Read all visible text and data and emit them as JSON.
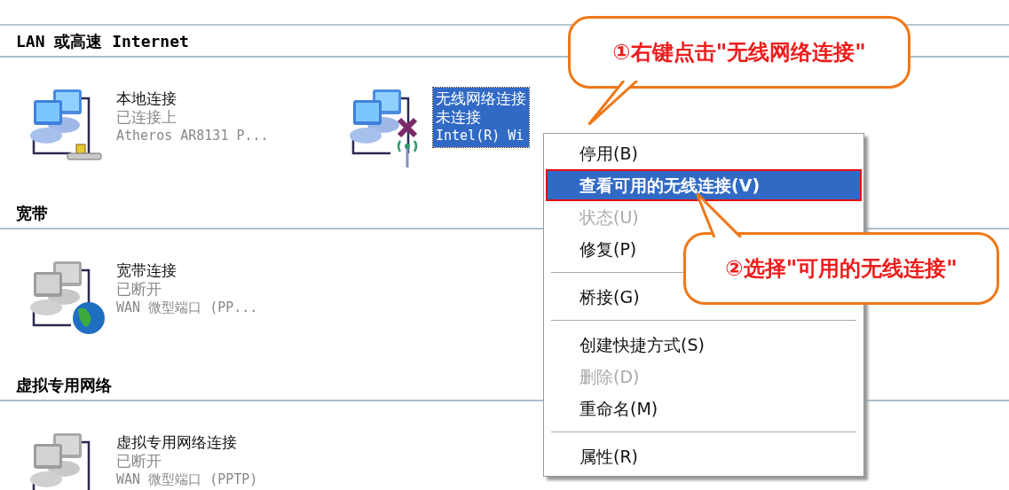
{
  "sections": [
    {
      "title": "LAN 或高速 Internet",
      "items": [
        {
          "kind": "lan",
          "name": "本地连接",
          "status": "已连接上",
          "device": "Atheros AR8131 P...",
          "selected": false
        },
        {
          "kind": "wireless",
          "name": "无线网络连接",
          "status": "未连接",
          "device": "Intel(R) Wi",
          "selected": true
        }
      ]
    },
    {
      "title": "宽带",
      "items": [
        {
          "kind": "broadband",
          "name": "宽带连接",
          "status": "已断开",
          "device": "WAN 微型端口 (PP...",
          "selected": false
        }
      ]
    },
    {
      "title": "虚拟专用网络",
      "items": [
        {
          "kind": "vpn",
          "name": "虚拟专用网络连接",
          "status": "已断开",
          "device": "WAN 微型端口 (PPTP)",
          "selected": false
        }
      ]
    }
  ],
  "context_menu": {
    "items": [
      {
        "kind": "item",
        "label": "停用(B)",
        "disabled": false,
        "selected": false
      },
      {
        "kind": "item",
        "label": "查看可用的无线连接(V)",
        "disabled": false,
        "selected": true
      },
      {
        "kind": "item",
        "label": "状态(U)",
        "disabled": true,
        "selected": false
      },
      {
        "kind": "item",
        "label": "修复(P)",
        "disabled": false,
        "selected": false
      },
      {
        "kind": "separator"
      },
      {
        "kind": "item",
        "label": "桥接(G)",
        "disabled": false,
        "selected": false
      },
      {
        "kind": "separator"
      },
      {
        "kind": "item",
        "label": "创建快捷方式(S)",
        "disabled": false,
        "selected": false
      },
      {
        "kind": "item",
        "label": "删除(D)",
        "disabled": true,
        "selected": false
      },
      {
        "kind": "item",
        "label": "重命名(M)",
        "disabled": false,
        "selected": false
      },
      {
        "kind": "separator"
      },
      {
        "kind": "item",
        "label": "属性(R)",
        "disabled": false,
        "selected": false
      }
    ]
  },
  "callouts": [
    {
      "text": "①右键点击\"无线网络连接\""
    },
    {
      "text": "②选择\"可用的无线连接\""
    }
  ]
}
